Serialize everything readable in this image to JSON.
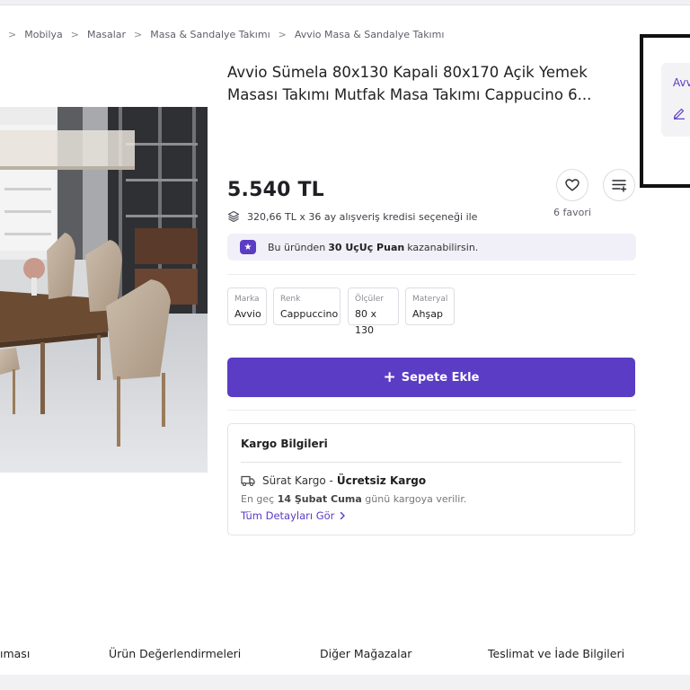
{
  "breadcrumb": [
    "Mobilya",
    "Masalar",
    "Masa & Sandalye Takımı",
    "Avvio Masa & Sandalye Takımı"
  ],
  "product": {
    "title": "Avvio Sümela 80x130 Kapali 80x170 Açik Yemek Masası Takımı Mutfak Masa Takımı Cappucino 6...",
    "price": "5.540 TL",
    "credit": "320,66 TL x 36 ay alışveriş kredisi seçeneği ile",
    "favorites": "6 favori"
  },
  "points": {
    "prefix": "Bu üründen",
    "bold": "30 UçUç Puan",
    "suffix": "kazanabilirsin."
  },
  "attributes": [
    {
      "key": "Marka",
      "value": "Avvio"
    },
    {
      "key": "Renk",
      "value": "Cappuccino"
    },
    {
      "key": "Ölçüler",
      "value": "80 x 130"
    },
    {
      "key": "Materyal",
      "value": "Ahşap"
    }
  ],
  "add_to_cart_label": "Sepete Ekle",
  "shipping": {
    "title": "Kargo Bilgileri",
    "carrier": "Sürat Kargo -",
    "carrier_bold": "Ücretsiz Kargo",
    "date_prefix": "En geç",
    "date_bold": "14 Şubat Cuma",
    "date_suffix": "günü kargoya verilir.",
    "details_link": "Tüm Detayları Gör"
  },
  "seller": {
    "label": "Avvi"
  },
  "tabs": [
    "ıması",
    "Ürün Değerlendirmeleri",
    "Diğer Mağazalar",
    "Teslimat ve İade Bilgileri"
  ],
  "colors": {
    "accent": "#5b3cc4",
    "text": "#222222",
    "muted": "#8b8b95"
  },
  "icons": [
    "chevron-right-icon",
    "heart-icon",
    "list-add-icon",
    "layers-icon",
    "star-icon",
    "truck-icon",
    "edit-icon",
    "plus-icon"
  ]
}
